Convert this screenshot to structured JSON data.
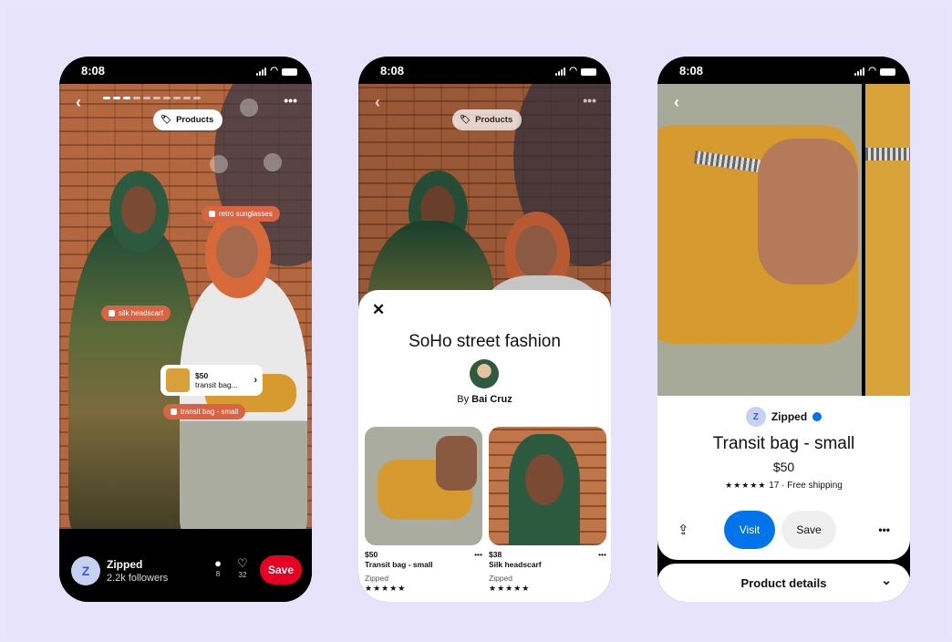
{
  "colors": {
    "background": "#e6e3fa",
    "accent_red": "#e60023",
    "tag_orange": "#d96443",
    "visit_blue": "#0074e8"
  },
  "status_time": "8:08",
  "phone1": {
    "products_pill": "Products",
    "tags": {
      "sunglasses": "retro sunglasses",
      "headscarf": "silk headscarf",
      "transit": "transit bag - small"
    },
    "mini_card": {
      "price": "$50",
      "name": "transit bag..."
    },
    "creator": {
      "avatar_letter": "Z",
      "name": "Zipped",
      "followers": "2.2k followers"
    },
    "comments": "8",
    "likes": "32",
    "save_label": "Save"
  },
  "phone2": {
    "products_pill": "Products",
    "title": "SoHo street fashion",
    "by_prefix": "By",
    "author": "Bai Cruz",
    "products": [
      {
        "price": "$50",
        "name": "Transit bag - small",
        "merchant": "Zipped",
        "stars": "★★★★★"
      },
      {
        "price": "$38",
        "name": "Silk headscarf",
        "merchant": "Zipped",
        "stars": "★★★★★"
      }
    ]
  },
  "phone3": {
    "merchant": "Zipped",
    "title": "Transit bag - small",
    "price": "$50",
    "stars": "★★★★★",
    "rating_text": "17 · Free shipping",
    "visit_label": "Visit",
    "save_label": "Save",
    "details_label": "Product details"
  }
}
